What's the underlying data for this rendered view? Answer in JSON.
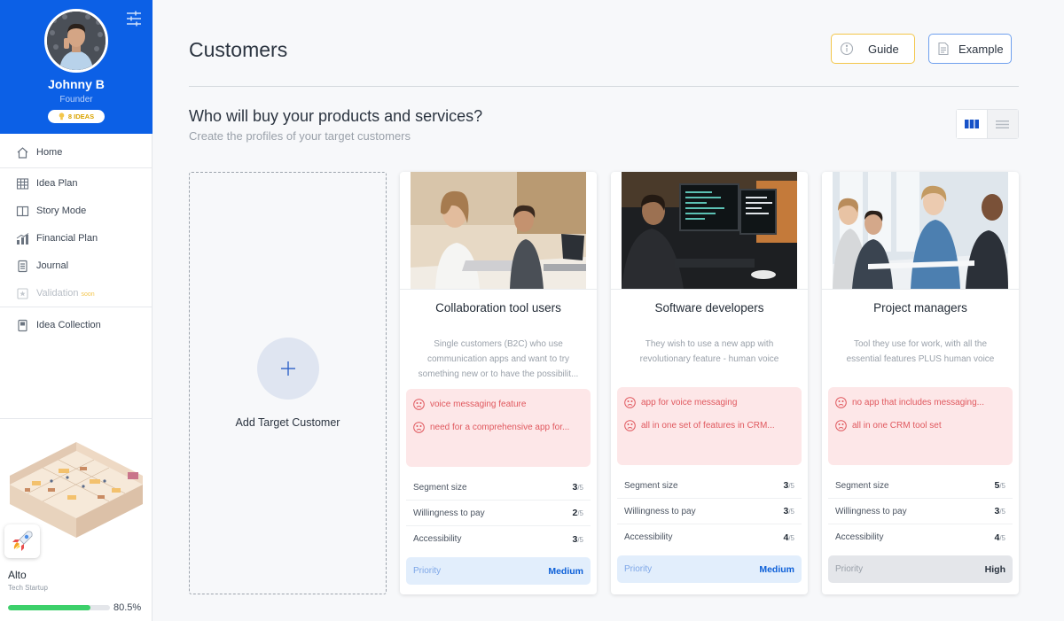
{
  "user": {
    "name": "Johnny B",
    "role": "Founder",
    "ideas_badge": "8 IDEAS"
  },
  "nav": [
    {
      "label": "Home",
      "icon": "home-icon"
    },
    {
      "label": "Idea Plan",
      "icon": "grid-icon"
    },
    {
      "label": "Story Mode",
      "icon": "book-icon"
    },
    {
      "label": "Financial Plan",
      "icon": "bar-chart-icon"
    },
    {
      "label": "Journal",
      "icon": "document-icon"
    },
    {
      "label": "Validation",
      "icon": "star-icon",
      "badge": "soon"
    },
    {
      "label": "Idea Collection",
      "icon": "collection-icon"
    }
  ],
  "idea": {
    "name": "Alto",
    "type": "Tech Startup",
    "progress_label": "80.5%",
    "progress": 0.805
  },
  "page": {
    "title": "Customers",
    "guide_label": "Guide",
    "example_label": "Example",
    "section_title": "Who will buy your products and services?",
    "section_subtitle": "Create the profiles of your target customers",
    "add_label": "Add Target Customer"
  },
  "colors": {
    "brand": "#0c60e6",
    "guide_border": "#f3c64a",
    "pain": "#e0585e",
    "progress": "#3cd06a"
  },
  "cards": [
    {
      "title": "Collaboration tool users",
      "description": "Single customers (B2C) who use communication apps and want to try something new or to have the possibilit...",
      "pains": [
        "voice messaging feature",
        "need for a comprehensive app for..."
      ],
      "metrics": [
        {
          "label": "Segment size",
          "value": "3",
          "max": "/5"
        },
        {
          "label": "Willingness to pay",
          "value": "2",
          "max": "/5"
        },
        {
          "label": "Accessibility",
          "value": "3",
          "max": "/5"
        }
      ],
      "priority_label": "Priority",
      "priority": "Medium"
    },
    {
      "title": "Software developers",
      "description": "They wish to use a new app with revolutionary feature - human voice",
      "pains": [
        "app for voice messaging",
        "all in one set of features in CRM..."
      ],
      "metrics": [
        {
          "label": "Segment size",
          "value": "3",
          "max": "/5"
        },
        {
          "label": "Willingness to pay",
          "value": "3",
          "max": "/5"
        },
        {
          "label": "Accessibility",
          "value": "4",
          "max": "/5"
        }
      ],
      "priority_label": "Priority",
      "priority": "Medium"
    },
    {
      "title": "Project managers",
      "description": "Tool they use for work, with all the essential features PLUS human voice",
      "pains": [
        "no app that includes messaging...",
        "all in one CRM tool set"
      ],
      "metrics": [
        {
          "label": "Segment size",
          "value": "5",
          "max": "/5"
        },
        {
          "label": "Willingness to pay",
          "value": "3",
          "max": "/5"
        },
        {
          "label": "Accessibility",
          "value": "4",
          "max": "/5"
        }
      ],
      "priority_label": "Priority",
      "priority": "High"
    }
  ]
}
